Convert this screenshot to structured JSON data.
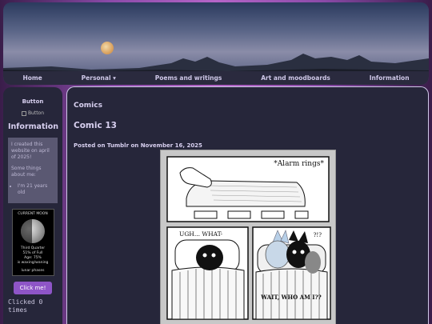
{
  "nav": {
    "items": [
      "Home",
      "Personal ▾",
      "Poems and writings",
      "Art and moodboards",
      "Information"
    ]
  },
  "sidebar": {
    "title": "Button",
    "image_alt": "Button",
    "info_heading": "Information",
    "info_intro": "I created this website on april of 2025!",
    "info_some": "Some things about me:",
    "info_list": [
      "I'm 21 years old"
    ],
    "moon": {
      "header": "CURRENT MOON",
      "phase": "Third Quarter",
      "percent": "51% of Full",
      "age": "Age: 75%",
      "status": "is waxing/waning",
      "footer": "lunar phases"
    },
    "click_button": "Click me!",
    "counter": "Clicked 0 times"
  },
  "main": {
    "section": "Comics",
    "title": "Comic 13",
    "posted": "Posted on Tumblr on November 16, 2025"
  },
  "comic": {
    "panel1_caption": "*Alarm rings*",
    "panel2_caption": "UGH... WHAT-",
    "panel3_caption1": "?!?",
    "panel3_caption2": "WAIT, WHO AM I??"
  },
  "colors": {
    "accent": "#8e55c7",
    "panel_bg": "#26263a",
    "text": "#d8d0f0"
  }
}
